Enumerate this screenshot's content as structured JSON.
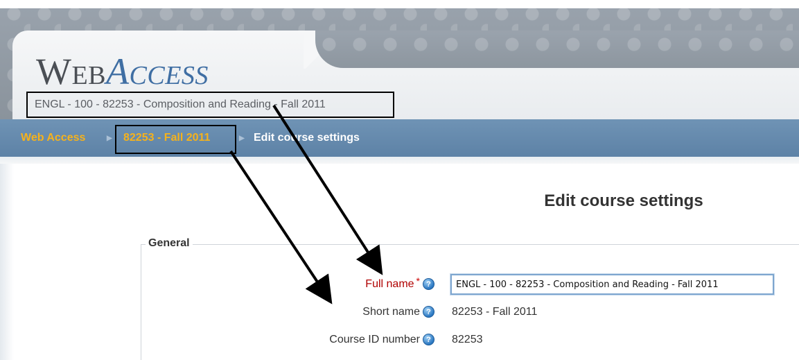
{
  "header": {
    "logo_first": "Web",
    "logo_second": "Access",
    "course_title": "ENGL - 100 - 82253 - Composition and Reading - Fall 2011"
  },
  "breadcrumb": {
    "home": "Web Access",
    "separator": "▶",
    "course": "82253 - Fall 2011",
    "current": "Edit course settings"
  },
  "main": {
    "title": "Edit course settings",
    "section_legend": "General",
    "fields": {
      "full_name": {
        "label": "Full name",
        "required_marker": "*",
        "value": "ENGL - 100 - 82253 - Composition and Reading - Fall 2011"
      },
      "short_name": {
        "label": "Short name",
        "value": "82253 - Fall 2011"
      },
      "course_id": {
        "label": "Course ID number",
        "value": "82253"
      }
    },
    "help_glyph": "?"
  },
  "icons": {
    "help": "help-icon",
    "separator": "triangle-right-icon"
  },
  "colors": {
    "nav_bar": "#6589ad",
    "breadcrumb_link": "#f6b21b",
    "required_label": "#b00000",
    "logo_accent": "#3f6ea3"
  }
}
